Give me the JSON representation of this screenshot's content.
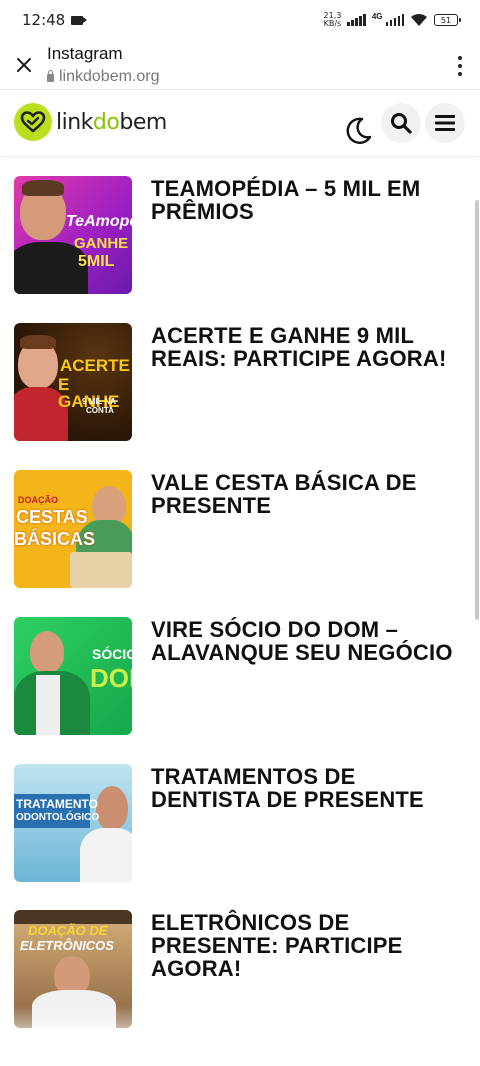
{
  "status_bar": {
    "time": "12:48",
    "net_speed_value": "21,3",
    "net_speed_unit": "KB/s",
    "network_type": "4G",
    "battery": "51"
  },
  "browser": {
    "title": "Instagram",
    "url": "linkdobem.org"
  },
  "site": {
    "logo_text_link": "link",
    "logo_text_do": "do",
    "logo_text_bem": "bem",
    "brand_color": "#b9df1f"
  },
  "articles": [
    {
      "title": "TEAMOPÉDIA – 5 MIL EM PRÊMIOS",
      "thumb_text": [
        "TeAmopéd",
        "GANHE",
        "5MIL"
      ]
    },
    {
      "title": "ACERTE E GANHE 9 MIL REAIS: PARTICIPE AGORA!",
      "thumb_text": [
        "ACERTE",
        "E GANHE",
        "9 MIL NA",
        "CONTA"
      ]
    },
    {
      "title": "VALE CESTA BÁSICA DE PRESENTE",
      "thumb_text": [
        "DOAÇÃO",
        "CESTAS",
        "BÁSICAS"
      ]
    },
    {
      "title": "VIRE SÓCIO DO DOM – ALAVANQUE SEU NEGÓCIO",
      "thumb_text": [
        "SÓCIO",
        "DOM"
      ]
    },
    {
      "title": "TRATAMENTOS DE DENTISTA DE PRESENTE",
      "thumb_text": [
        "TRATAMENTO",
        "ODONTOLÓGICO"
      ]
    },
    {
      "title": "ELETRÔNICOS DE PRESENTE: PARTICIPE AGORA!",
      "thumb_text": [
        "DOAÇÃO DE",
        "ELETRÔNICOS"
      ]
    }
  ]
}
